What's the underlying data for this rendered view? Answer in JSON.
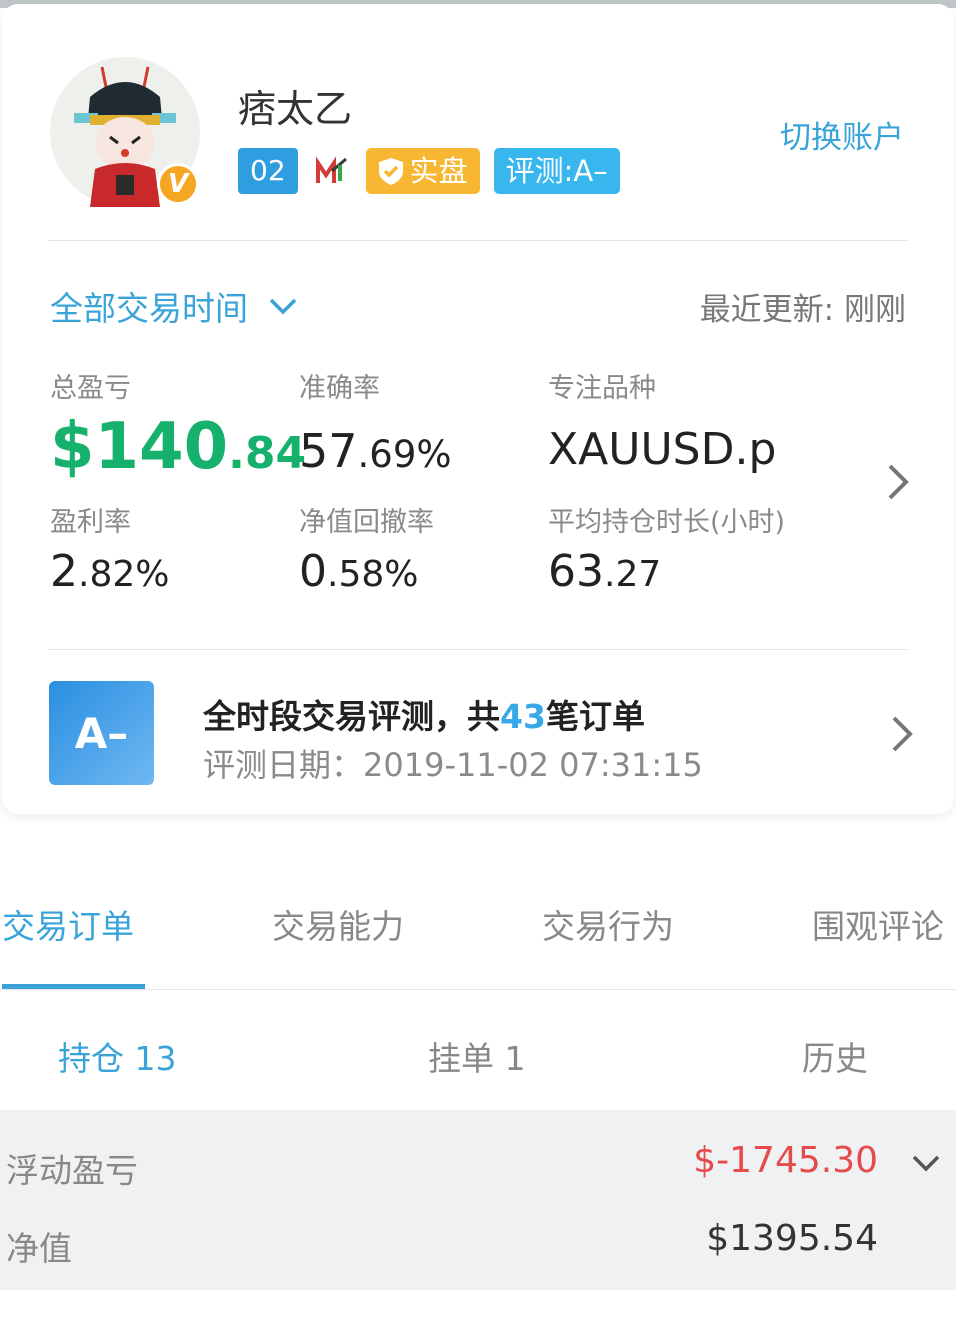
{
  "profile": {
    "username": "痞太乙",
    "switch_account": "切换账户",
    "level_tag": "02",
    "live_tag": "实盘",
    "rating_tag": "评测:A–",
    "verified_badge": "V"
  },
  "filter": {
    "period": "全部交易时间",
    "updated": "最近更新: 刚刚"
  },
  "stats": {
    "total_pl_label": "总盈亏",
    "total_pl_main": "$140",
    "total_pl_dec": ".84",
    "accuracy_label": "准确率",
    "accuracy_main": "57",
    "accuracy_dec": ".69%",
    "focus_label": "专注品种",
    "focus_value": "XAUUSD.p",
    "profit_rate_label": "盈利率",
    "profit_rate_main": "2",
    "profit_rate_dec": ".82%",
    "drawdown_label": "净值回撤率",
    "drawdown_main": "0",
    "drawdown_dec": ".58%",
    "avg_hold_label": "平均持仓时长(小时)",
    "avg_hold_main": "63",
    "avg_hold_dec": ".27"
  },
  "evaluation": {
    "grade": "A–",
    "title_prefix": "全时段交易评测，共",
    "order_count": "43",
    "title_suffix": "笔订单",
    "date": "评测日期：2019-11-02 07:31:15"
  },
  "tabs": [
    "交易订单",
    "交易能力",
    "交易行为",
    "围观评论"
  ],
  "subtabs": [
    "持仓 13",
    "挂单 1",
    "历史"
  ],
  "summary": {
    "floating_label": "浮动盈亏",
    "floating_value": "$-1745.30",
    "equity_label": "净值",
    "equity_value": "$1395.54"
  },
  "colors": {
    "accent": "#3aa3d8",
    "profit_green": "#16b26d",
    "loss_red": "#e64b4b",
    "live_orange": "#f7b733"
  }
}
